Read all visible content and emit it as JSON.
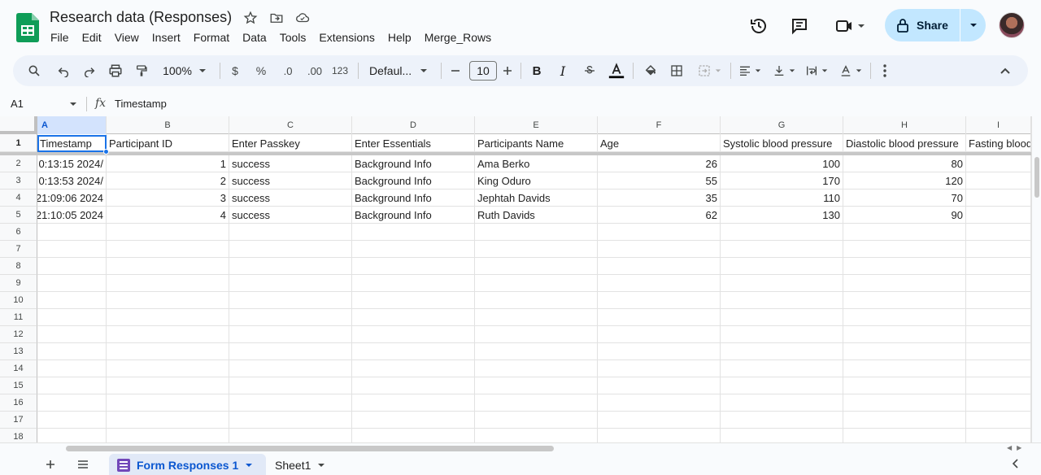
{
  "app": {
    "title": "Research data (Responses)",
    "menu": [
      "File",
      "Edit",
      "View",
      "Insert",
      "Format",
      "Data",
      "Tools",
      "Extensions",
      "Help",
      "Merge_Rows"
    ],
    "share_label": "Share"
  },
  "toolbar": {
    "zoom": "100%",
    "currency": "$",
    "percent": "%",
    "dec_decrease": ".0",
    "dec_increase": ".00",
    "number_format": "123",
    "font": "Defaul...",
    "font_size": "10"
  },
  "formula_bar": {
    "cell_ref": "A1",
    "fx": "fx",
    "content": "Timestamp"
  },
  "sheet": {
    "columns": [
      "A",
      "B",
      "C",
      "D",
      "E",
      "F",
      "G",
      "H",
      "I"
    ],
    "row_numbers": [
      "1",
      "2",
      "3",
      "4",
      "5",
      "6",
      "7",
      "8",
      "9",
      "10",
      "11",
      "12",
      "13",
      "14",
      "15",
      "16",
      "17",
      "18"
    ],
    "headers": [
      "Timestamp",
      "Participant ID",
      "Enter Passkey",
      "Enter Essentials",
      "Participants Name",
      "Age",
      "Systolic blood pressure",
      "Diastolic blood pressure",
      "Fasting blood"
    ],
    "rows": [
      [
        "/2024 0:13:15",
        "1",
        "success",
        "Background Info",
        "Ama Berko",
        "26",
        "100",
        "80",
        ""
      ],
      [
        "/2024 0:13:53",
        "2",
        "success",
        "Background Info",
        "King Oduro",
        "55",
        "170",
        "120",
        ""
      ],
      [
        "2024 21:09:06",
        "3",
        "success",
        "Background Info",
        "Jephtah Davids",
        "35",
        "110",
        "70",
        ""
      ],
      [
        "2024 21:10:05",
        "4",
        "success",
        "Background Info",
        "Ruth Davids",
        "62",
        "130",
        "90",
        ""
      ]
    ]
  },
  "tabs": {
    "active": "Form Responses 1",
    "other": "Sheet1"
  },
  "colors": {
    "share_bg": "#c2e7ff",
    "selection": "#1a73e8",
    "active_tab_bg": "#e1e9f7",
    "sheets_green": "#0f9d58"
  }
}
